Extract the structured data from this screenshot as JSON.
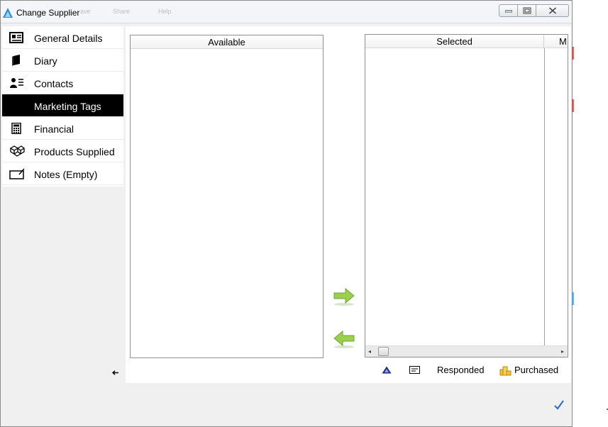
{
  "window": {
    "title": "Change Supplier",
    "ghost_toolbar": [
      "ave",
      "Share",
      "Help"
    ]
  },
  "window_controls": {
    "minimize_icon": "minimize-icon",
    "maximize_icon": "maximize-icon",
    "close_icon": "close-icon"
  },
  "sidebar": {
    "items": [
      {
        "label": "General Details",
        "icon": "newspaper-icon",
        "active": false
      },
      {
        "label": "Diary",
        "icon": "book-icon",
        "active": false
      },
      {
        "label": "Contacts",
        "icon": "contact-list-icon",
        "active": false
      },
      {
        "label": "Marketing Tags",
        "icon": "",
        "active": true
      },
      {
        "label": "Financial",
        "icon": "calculator-icon",
        "active": false
      },
      {
        "label": "Products Supplied",
        "icon": "boxes-icon",
        "active": false
      },
      {
        "label": "Notes (Empty)",
        "icon": "note-icon",
        "active": false
      }
    ],
    "collapse_glyph": "➔"
  },
  "available_list": {
    "header": "Available",
    "rows": []
  },
  "selected_list": {
    "columns": [
      "Selected",
      "M"
    ],
    "rows": []
  },
  "legend": {
    "responded_label": "Responded",
    "purchased_label": "Purchased"
  },
  "colors": {
    "active_nav_bg": "#000000",
    "arrow_green": "#8cc63f",
    "check_blue": "#3a6fc4"
  }
}
